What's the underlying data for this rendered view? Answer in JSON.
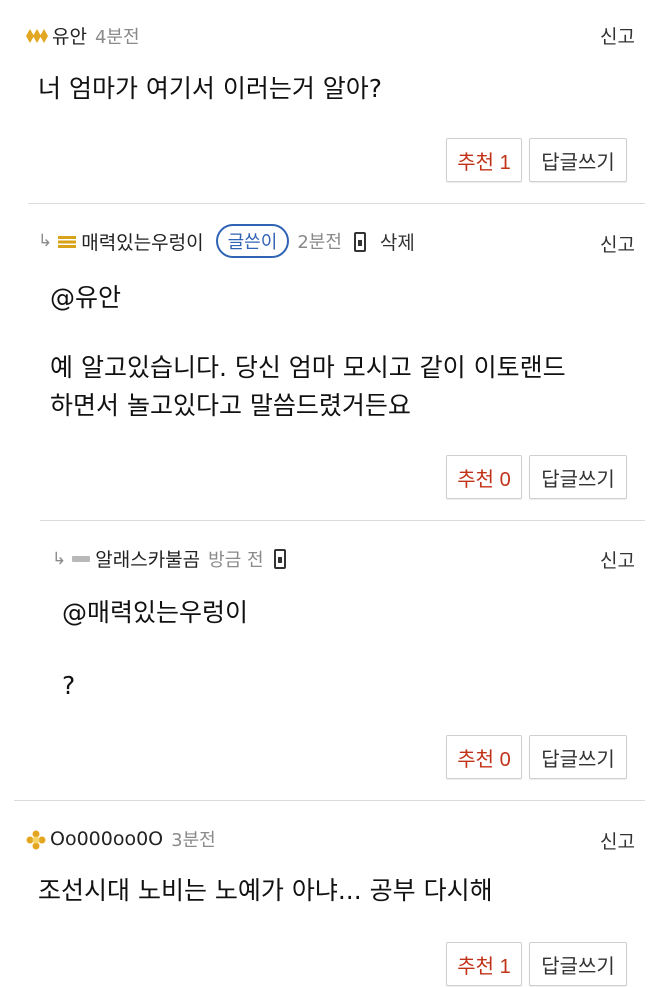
{
  "comments": [
    {
      "nickname": "유안",
      "time": "4분전",
      "report": "신고",
      "text": "너 엄마가 여기서 이러는거 알아?",
      "recommend": "추천 1",
      "reply": "답글쓰기",
      "level_icon": "gold-diamond-level-icon"
    },
    {
      "nickname": "매력있는우렁이",
      "badge": "글쓴이",
      "time": "2분전",
      "delete": "삭제",
      "report": "신고",
      "text_line1": "@유안",
      "text_line2": "예 알고있습니다. 당신 엄마 모시고 같이 이토랜드",
      "text_line3": "하면서 놀고있다고 말씀드렸거든요",
      "recommend": "추천 0",
      "reply": "답글쓰기",
      "level_icon": "gold-bars-level-icon"
    },
    {
      "nickname": "알래스카불곰",
      "time": "방금 전",
      "report": "신고",
      "text_line1": "@매력있는우렁이",
      "text_line2": "?",
      "recommend": "추천 0",
      "reply": "답글쓰기",
      "level_icon": "gray-bar-level-icon"
    },
    {
      "nickname": "Oo000oo0O",
      "time": "3분전",
      "report": "신고",
      "text": "조선시대 노비는 노예가 아냐... 공부 다시해",
      "recommend": "추천 1",
      "reply": "답글쓰기",
      "level_icon": "gold-flower-level-icon"
    }
  ],
  "colors": {
    "recommend_text": "#c03318",
    "author_badge": "#2f63b4",
    "time_text": "#8a8a8a",
    "divider": "#dcdcdc"
  }
}
